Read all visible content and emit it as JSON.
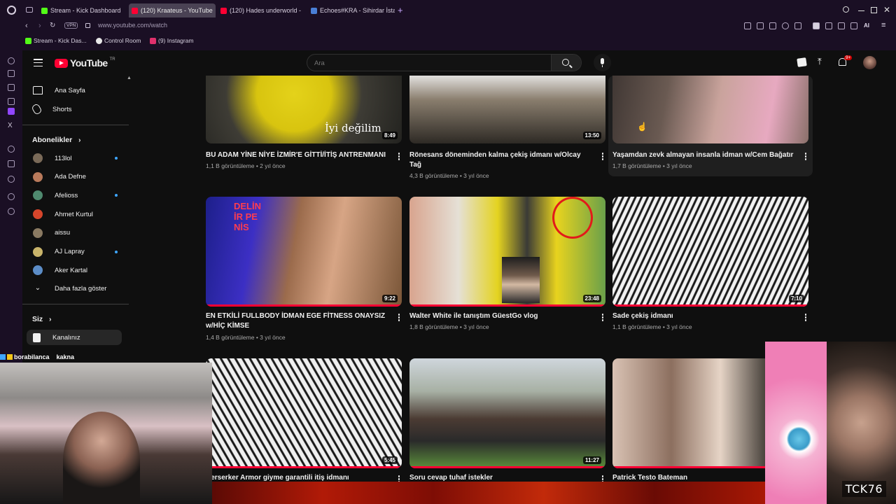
{
  "browser": {
    "tabs": [
      {
        "label": "Stream - Kick Dashboard",
        "color": "#53fc18"
      },
      {
        "label": "(120) Kraateus - YouTube",
        "color": "#ff0033"
      },
      {
        "label": "(120) Hades underworld -",
        "color": "#ff0033"
      },
      {
        "label": "Echoes#KRA - Sihirdar İsta",
        "color": "#4a7fd6"
      }
    ],
    "url": "www.youtube.com/watch",
    "vpn_label": "VPN",
    "ai_label": "AI",
    "bookmarks": [
      {
        "label": "Stream - Kick Das...",
        "color": "#53fc18"
      },
      {
        "label": "Control Room",
        "color": "#e8e8e8"
      },
      {
        "label": "(9) Instagram",
        "color": "#e1306c"
      }
    ]
  },
  "youtube": {
    "logo_text": "YouTube",
    "country": "TR",
    "search_placeholder": "Ara",
    "notif_count": "9+",
    "sidebar": {
      "home": "Ana Sayfa",
      "shorts": "Shorts",
      "subs_heading": "Abonelikler",
      "subs": [
        {
          "name": "113lol",
          "dot": true,
          "color": "#7a6a58"
        },
        {
          "name": "Ada Defne",
          "dot": false,
          "color": "#b97a5b"
        },
        {
          "name": "Afelioss",
          "dot": true,
          "color": "#4f8a6f"
        },
        {
          "name": "Ahmet Kurtul",
          "dot": false,
          "color": "#d6452b"
        },
        {
          "name": "aissu",
          "dot": false,
          "color": "#8a7a62"
        },
        {
          "name": "AJ Lapray",
          "dot": true,
          "color": "#c9b46a"
        },
        {
          "name": "Aker Kartal",
          "dot": false,
          "color": "#5c8dc7"
        }
      ],
      "show_more": "Daha fazla göster",
      "you_heading": "Siz",
      "channel": "Kanalınız"
    },
    "videos": [
      {
        "title": "BU ADAM YİNE NİYE İZMİR'E GİTTİ/İTİŞ ANTRENMANI",
        "meta": "1,1 B görüntüleme • 2 yıl önce",
        "duration": "8:49",
        "overlay_text": "İyi değilim"
      },
      {
        "title": "Rönesans döneminden kalma çekiş idmanı w/Olcay Tağ",
        "meta": "4,3 B görüntüleme • 3 yıl önce",
        "duration": "13:50"
      },
      {
        "title": "Yaşamdan zevk almayan insanla idman w/Cem Bağatır",
        "meta": "1,7 B görüntüleme • 3 yıl önce",
        "duration": ""
      },
      {
        "title": "EN ETKİLİ FULLBODY İDMAN EGE FİTNESS ONAYSIZ w/HİÇ KİMSE",
        "meta": "1,4 B görüntüleme • 3 yıl önce",
        "duration": "9:22",
        "overlay_text": "DELİNİR PENİS"
      },
      {
        "title": "Walter White ile tanıştım GüestGo vlog",
        "meta": "1,8 B görüntüleme • 3 yıl önce",
        "duration": "23:48"
      },
      {
        "title": "Sade çekiş idmanı",
        "meta": "1,1 B görüntüleme • 3 yıl önce",
        "duration": "7:10"
      },
      {
        "title": "Berserker Armor giyme garantili itiş idmanı",
        "meta": "",
        "duration": "5:45"
      },
      {
        "title": "Soru cevap tuhaf istekler",
        "meta": "",
        "duration": "11:27"
      },
      {
        "title": "Patrick Testo Bateman",
        "meta": "",
        "duration": ""
      }
    ]
  },
  "overlay": {
    "chat_user": "borabilanca",
    "chat_text": "kakna",
    "tag": "TCK76"
  }
}
